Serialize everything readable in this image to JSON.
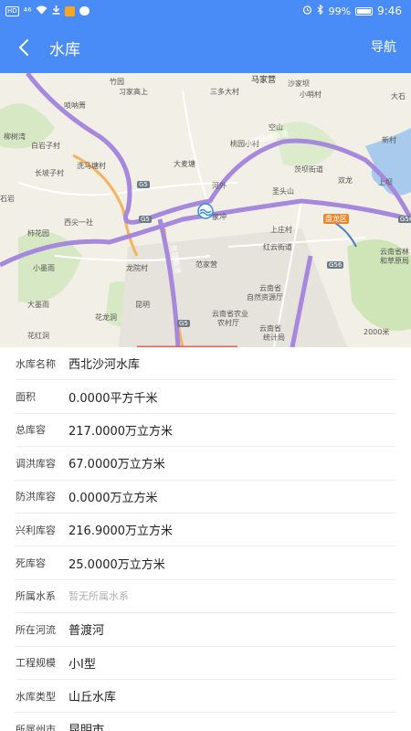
{
  "status_bar": {
    "network": "HD",
    "signal": "⁴⁶",
    "battery": "99%",
    "time": "9:46"
  },
  "header": {
    "title": "水库",
    "nav_label": "导航",
    "color": "#4a8cf7"
  },
  "map": {
    "labels": [
      {
        "text": "马家营",
        "kind": "dark"
      },
      {
        "text": "竹园",
        "kind": ""
      },
      {
        "text": "沙家坝",
        "kind": ""
      },
      {
        "text": "唢呐箐",
        "kind": ""
      },
      {
        "text": "习家高上",
        "kind": ""
      },
      {
        "text": "三多大村",
        "kind": ""
      },
      {
        "text": "小哨村",
        "kind": ""
      },
      {
        "text": "大石",
        "kind": ""
      },
      {
        "text": "柳树湾",
        "kind": ""
      },
      {
        "text": "白岩子村",
        "kind": ""
      },
      {
        "text": "桃园小村",
        "kind": ""
      },
      {
        "text": "空山",
        "kind": ""
      },
      {
        "text": "昆明绕城高速",
        "kind": ""
      },
      {
        "text": "新村",
        "kind": ""
      },
      {
        "text": "长坡子村",
        "kind": ""
      },
      {
        "text": "洗马塘村",
        "kind": ""
      },
      {
        "text": "大麦塘",
        "kind": ""
      },
      {
        "text": "茨坝街道",
        "kind": ""
      },
      {
        "text": "石岩",
        "kind": ""
      },
      {
        "text": "河外",
        "kind": ""
      },
      {
        "text": "圣头山",
        "kind": ""
      },
      {
        "text": "双龙",
        "kind": ""
      },
      {
        "text": "上坝",
        "kind": ""
      },
      {
        "text": "西尖一社",
        "kind": ""
      },
      {
        "text": "家冲",
        "kind": ""
      },
      {
        "text": "盘龙区",
        "kind": "district"
      },
      {
        "text": "柿花园",
        "kind": ""
      },
      {
        "text": "上庄村",
        "kind": ""
      },
      {
        "text": "红云街道",
        "kind": ""
      },
      {
        "text": "云南省林",
        "kind": ""
      },
      {
        "text": "和草原局",
        "kind": ""
      },
      {
        "text": "小墨雨",
        "kind": ""
      },
      {
        "text": "龙院村",
        "kind": ""
      },
      {
        "text": "范家营",
        "kind": ""
      },
      {
        "text": "云南省",
        "kind": ""
      },
      {
        "text": "自然资源厅",
        "kind": ""
      },
      {
        "text": "大墨雨",
        "kind": ""
      },
      {
        "text": "云南省农业",
        "kind": ""
      },
      {
        "text": "农村厅",
        "kind": ""
      },
      {
        "text": "云南省",
        "kind": ""
      },
      {
        "text": "统计局",
        "kind": ""
      },
      {
        "text": "花红洞",
        "kind": ""
      },
      {
        "text": "昆明",
        "kind": ""
      },
      {
        "text": "花龙洞",
        "kind": ""
      },
      {
        "text": "京昆高速",
        "kind": ""
      },
      {
        "text": "G5",
        "kind": "shield"
      },
      {
        "text": "G5",
        "kind": "shield"
      },
      {
        "text": "G5",
        "kind": "shield"
      },
      {
        "text": "G56",
        "kind": "shield"
      },
      {
        "text": "G56",
        "kind": "shield"
      },
      {
        "text": "2000米",
        "kind": ""
      }
    ]
  },
  "details": [
    {
      "label": "水库名称",
      "value": "西北沙河水库",
      "empty": false
    },
    {
      "label": "面积",
      "value": "0.0000平方千米",
      "empty": false
    },
    {
      "label": "总库容",
      "value": "217.0000万立方米",
      "empty": false
    },
    {
      "label": "调洪库容",
      "value": "67.0000万立方米",
      "empty": false
    },
    {
      "label": "防洪库容",
      "value": "0.0000万立方米",
      "empty": false
    },
    {
      "label": "兴利库容",
      "value": "216.9000万立方米",
      "empty": false
    },
    {
      "label": "死库容",
      "value": "25.0000万立方米",
      "empty": false
    },
    {
      "label": "所属水系",
      "value": "暂无所属水系",
      "empty": true
    },
    {
      "label": "所在河流",
      "value": "普渡河",
      "empty": false
    },
    {
      "label": "工程规模",
      "value": "小I型",
      "empty": false
    },
    {
      "label": "水库类型",
      "value": "山丘水库",
      "empty": false
    },
    {
      "label": "所属州市",
      "value": "昆明市",
      "empty": false
    }
  ]
}
